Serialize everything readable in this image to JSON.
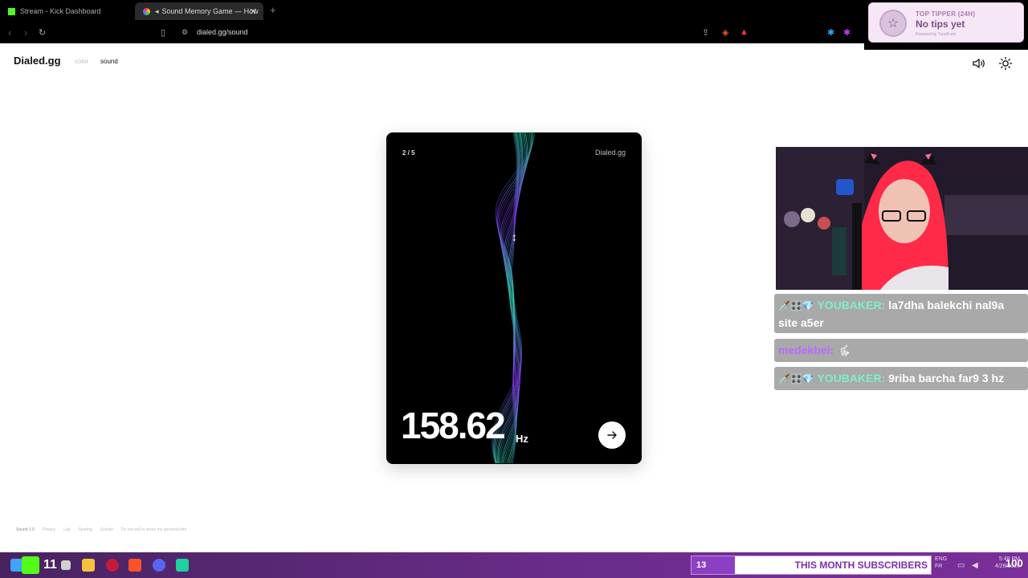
{
  "browser": {
    "tabs": [
      {
        "label": "Stream - Kick Dashboard",
        "active": false
      },
      {
        "label": "Sound Memory Game — How",
        "active": true
      }
    ],
    "url": "dialed.gg/sound"
  },
  "tip_widget": {
    "title": "TOP TIPPER (24H)",
    "message": "No tips yet",
    "powered": "Powered by TunoFuno"
  },
  "site": {
    "brand": "Dialed.gg",
    "nav": [
      "color",
      "sound"
    ],
    "active_nav": "sound"
  },
  "game": {
    "step": "2 / 5",
    "card_brand": "Dialed.gg",
    "frequency": "158.62",
    "unit": "Hz"
  },
  "chat": [
    {
      "badge": "🗡️🎛️💎",
      "user": "YOUBAKER:",
      "text": "la7dha balekchi nal9a site a5er"
    },
    {
      "badge": "",
      "user": "medekbel:",
      "text": "🐇"
    },
    {
      "badge": "🗡️🎛️💎",
      "user": "YOUBAKER:",
      "text": "9riba barcha far9 3 hz"
    }
  ],
  "footer": [
    "Sound 1.0",
    "Privacy",
    "Lab",
    "Scoring",
    "Suicide",
    "Do not sell or share my personal info"
  ],
  "taskbar": {
    "subs_count": "13",
    "subs_label": "THIS MONTH SUBSCRIBERS",
    "subs_goal": "100",
    "lang_top": "ENG",
    "lang_bottom": "FR",
    "time": "5:48 PM",
    "date": "4/26/2026",
    "k_count": "11"
  },
  "colors": {
    "wave_teal": "#2ee6c0",
    "wave_purple": "#8b3cff",
    "taskbar": "#6a2c8a",
    "subs_accent": "#8d3fc4"
  }
}
